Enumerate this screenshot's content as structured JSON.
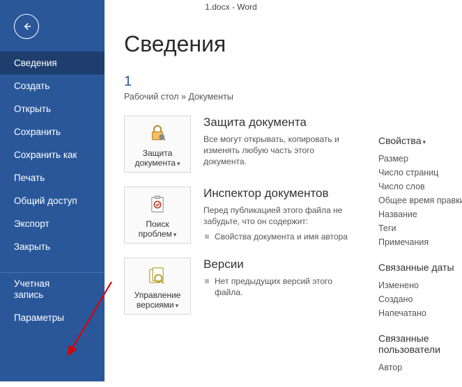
{
  "titlebar": "1.docx - Word",
  "sidebar": {
    "items": [
      {
        "key": "info",
        "label": "Сведения",
        "active": true
      },
      {
        "key": "new",
        "label": "Создать"
      },
      {
        "key": "open",
        "label": "Открыть"
      },
      {
        "key": "save",
        "label": "Сохранить"
      },
      {
        "key": "saveas",
        "label": "Сохранить как"
      },
      {
        "key": "print",
        "label": "Печать"
      },
      {
        "key": "share",
        "label": "Общий доступ"
      },
      {
        "key": "export",
        "label": "Экспорт"
      },
      {
        "key": "close",
        "label": "Закрыть"
      }
    ],
    "account": "Учетная\nзапись",
    "options": "Параметры"
  },
  "page": {
    "title": "Сведения",
    "docname": "1",
    "breadcrumb": "Рабочий стол » Документы",
    "protect": {
      "button": "Защита документа",
      "heading": "Защита документа",
      "desc": "Все могут открывать, копировать и изменять любую часть этого документа."
    },
    "inspect": {
      "button": "Поиск проблем",
      "heading": "Инспектор документов",
      "desc": "Перед публикацией этого файла не забудьте, что он содержит:",
      "items": [
        "Свойства документа и имя автора"
      ]
    },
    "versions": {
      "button": "Управление версиями",
      "heading": "Версии",
      "items": [
        "Нет предыдущих версий этого файла."
      ]
    }
  },
  "props": {
    "heading": "Свойства",
    "rows": [
      "Размер",
      "Число страниц",
      "Число слов",
      "Общее время правки",
      "Название",
      "Теги",
      "Примечания"
    ],
    "dates_heading": "Связанные даты",
    "dates_rows": [
      "Изменено",
      "Создано",
      "Напечатано"
    ],
    "people_heading": "Связанные пользователи",
    "people_rows": [
      "Автор"
    ]
  }
}
